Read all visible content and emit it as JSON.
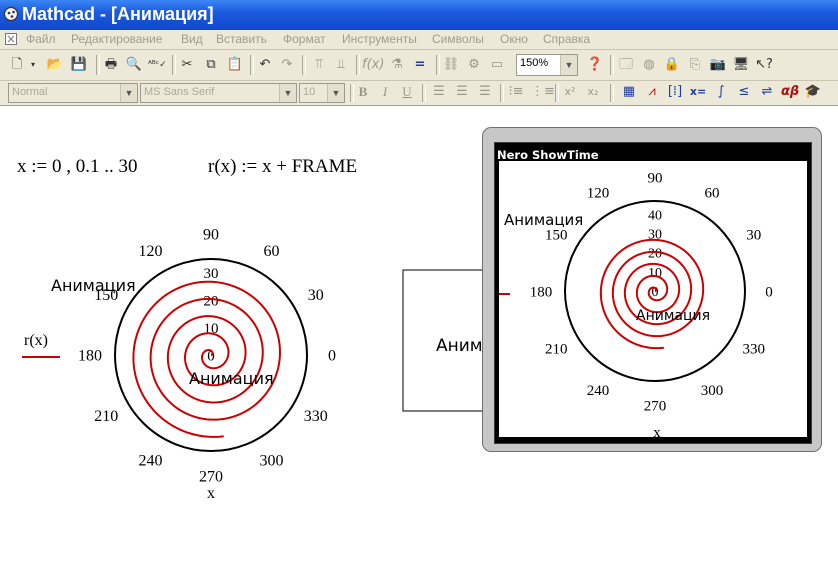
{
  "window": {
    "title": "Mathcad - [Анимация]"
  },
  "menu": [
    "Файл",
    "Редактирование",
    "Вид",
    "Вставить",
    "Формат",
    "Инструменты",
    "Символы",
    "Окно",
    "Справка"
  ],
  "toolbar": {
    "zoom": "150%"
  },
  "format_bar": {
    "style": "Normal",
    "font": "MS Sans Serif",
    "size": "10"
  },
  "worksheet": {
    "range_def": "x := 0 , 0.1 .. 30",
    "func_def": "r(x) := x + FRAME",
    "legend_label": "r(x)",
    "x_label": "x",
    "plot_text_1": "Анимация",
    "plot_text_2": "Анимация",
    "box_text": "Аним",
    "curve_color": "#cc0000"
  },
  "player": {
    "title": "Nero ShowTime",
    "text_1": "Анимация",
    "text_2": "Анимация",
    "x_label": "x"
  },
  "chart_data": [
    {
      "type": "polar",
      "title": "",
      "series": [
        {
          "name": "r(x)",
          "function": "r(x) = x + FRAME",
          "theta_range": [
            0,
            30
          ],
          "theta_step": 0.1,
          "color": "#cc0000"
        }
      ],
      "angle_ticks": [
        "0",
        "30",
        "60",
        "90",
        "120",
        "150",
        "180",
        "210",
        "240",
        "270",
        "300",
        "330"
      ],
      "radial_ticks": [
        "0",
        "10",
        "20",
        "30"
      ],
      "rmax": 35,
      "xlabel": "x"
    },
    {
      "type": "polar",
      "title": "",
      "angle_ticks": [
        "0",
        "30",
        "60",
        "90",
        "120",
        "150",
        "180",
        "210",
        "240",
        "270",
        "300",
        "330"
      ],
      "radial_ticks": [
        "0",
        "10",
        "20",
        "30",
        "40"
      ],
      "rmax": 47,
      "xlabel": "x"
    }
  ]
}
